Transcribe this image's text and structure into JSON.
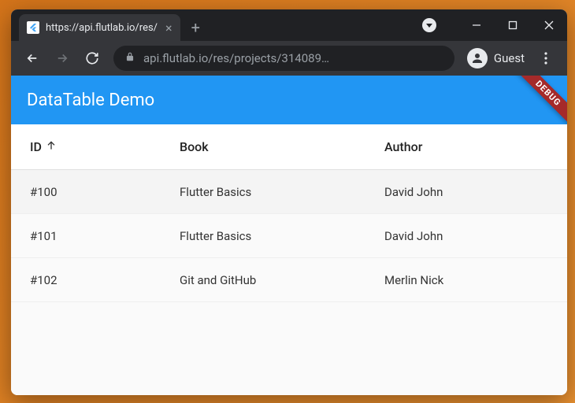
{
  "browser": {
    "tab_title": "https://api.flutlab.io/res/",
    "url_display": "api.flutlab.io/res/projects/314089…",
    "guest_label": "Guest"
  },
  "appbar": {
    "title": "DataTable Demo",
    "debug_label": "DEBUG"
  },
  "table": {
    "columns": {
      "id": "ID",
      "book": "Book",
      "author": "Author"
    },
    "rows": [
      {
        "id": "#100",
        "book": "Flutter Basics",
        "author": "David John",
        "selected": true
      },
      {
        "id": "#101",
        "book": "Flutter Basics",
        "author": "David John",
        "selected": false
      },
      {
        "id": "#102",
        "book": "Git and GitHub",
        "author": "Merlin Nick",
        "selected": false
      }
    ]
  }
}
